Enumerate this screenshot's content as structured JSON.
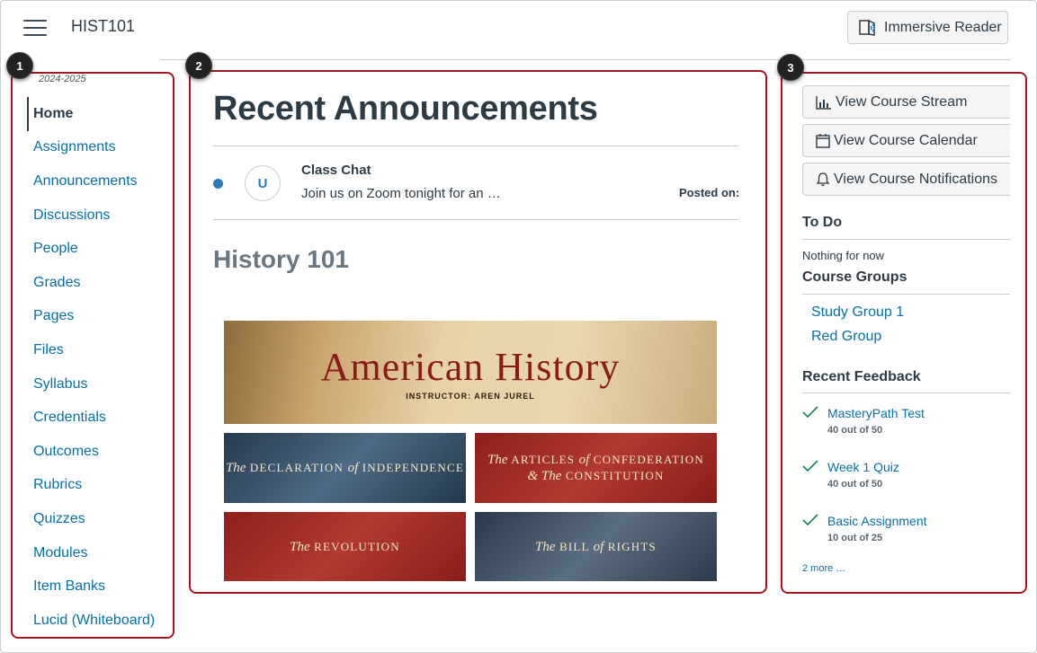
{
  "header": {
    "course_code": "HIST101",
    "immersive_reader_label": "Immersive Reader"
  },
  "callouts": [
    "1",
    "2",
    "3"
  ],
  "sidebar": {
    "term": "2024-2025",
    "items": [
      {
        "label": "Home",
        "active": true
      },
      {
        "label": "Assignments"
      },
      {
        "label": "Announcements"
      },
      {
        "label": "Discussions"
      },
      {
        "label": "People"
      },
      {
        "label": "Grades"
      },
      {
        "label": "Pages"
      },
      {
        "label": "Files"
      },
      {
        "label": "Syllabus"
      },
      {
        "label": "Credentials"
      },
      {
        "label": "Outcomes"
      },
      {
        "label": "Rubrics"
      },
      {
        "label": "Quizzes"
      },
      {
        "label": "Modules"
      },
      {
        "label": "Item Banks"
      },
      {
        "label": "Lucid (Whiteboard)"
      }
    ]
  },
  "main": {
    "title": "Recent Announcements",
    "announcement": {
      "avatar_initial": "U",
      "title": "Class Chat",
      "snippet": "Join us on Zoom tonight for an …",
      "posted_label": "Posted on:"
    },
    "course_title": "History 101",
    "banner": {
      "title": "American History",
      "subtitle": "INSTRUCTOR: AREN JUREL"
    },
    "tiles": [
      {
        "line1_pre": "The",
        "line1": "DECLARATION",
        "mid": "of",
        "line2": "INDEPENDENCE"
      },
      {
        "line1_pre": "The",
        "line1": "ARTICLES",
        "mid": "of",
        "line2": "CONFEDERATION",
        "line3_pre": "& The",
        "line3": "CONSTITUTION"
      },
      {
        "line1_pre": "The",
        "line1": "REVOLUTION"
      },
      {
        "line1_pre": "The",
        "line1": "BILL",
        "mid": "of",
        "line2": "RIGHTS"
      }
    ]
  },
  "right": {
    "buttons": {
      "stream": "View Course Stream",
      "calendar": "View Course Calendar",
      "notifications": "View Course Notifications"
    },
    "todo_heading": "To Do",
    "todo_empty": "Nothing for now",
    "groups_heading": "Course Groups",
    "groups": [
      "Study Group 1",
      "Red Group"
    ],
    "feedback_heading": "Recent Feedback",
    "feedback": [
      {
        "title": "MasteryPath Test",
        "score": "40 out of 50"
      },
      {
        "title": "Week 1 Quiz",
        "score": "40 out of 50"
      },
      {
        "title": "Basic Assignment",
        "score": "10 out of 25"
      }
    ],
    "more_label": "2 more …"
  },
  "colors": {
    "link": "#0770a3",
    "callout_border": "#a4161f",
    "check": "#0b874b",
    "unread": "#2b7abc"
  }
}
